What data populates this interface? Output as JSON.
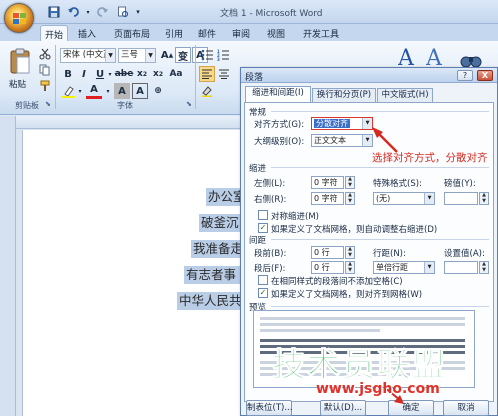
{
  "window": {
    "title": "文档 1 - Microsoft Word"
  },
  "ribbon": {
    "tabs": [
      "开始",
      "插入",
      "页面布局",
      "引用",
      "邮件",
      "审阅",
      "视图",
      "开发工具"
    ],
    "active_tab": "开始",
    "font_name": "宋体 (中文正)",
    "font_size": "三号",
    "clipboard_group": "剪贴板",
    "font_group": "字体",
    "paste_label": "粘贴",
    "wen_glyph": "变",
    "a_glyph": "A"
  },
  "document": {
    "lines": [
      "办公室",
      "破釜沉",
      "我准备走",
      "有志者事",
      "中华人民共"
    ]
  },
  "dialog": {
    "title": "段落",
    "help": "?",
    "close": "X",
    "tabs": [
      "缩进和间距(I)",
      "换行和分页(P)",
      "中文版式(H)"
    ],
    "general": {
      "heading": "常规",
      "alignment_label": "对齐方式(G):",
      "alignment_value": "分散对齐",
      "outline_label": "大纲级别(O):",
      "outline_value": "正文文本"
    },
    "indent": {
      "heading": "缩进",
      "left_label": "左侧(L):",
      "left_value": "0 字符",
      "right_label": "右侧(R):",
      "right_value": "0 字符",
      "special_label": "特殊格式(S):",
      "special_value": "(无)",
      "by_label": "磅值(Y):",
      "by_value": "",
      "mirror_label": "对称缩进(M)",
      "mirror_checked": false,
      "auto_adjust_label": "如果定义了文档网格，则自动调整右缩进(D)",
      "auto_adjust_checked": true
    },
    "spacing": {
      "heading": "间距",
      "before_label": "段前(B):",
      "before_value": "0 行",
      "after_label": "段后(F):",
      "after_value": "0 行",
      "line_label": "行距(N):",
      "line_value": "单倍行距",
      "at_label": "设置值(A):",
      "at_value": "",
      "no_space_label": "在相同样式的段落间不添加空格(C)",
      "no_space_checked": false,
      "snap_grid_label": "如果定义了文档网格，则对齐到网格(W)",
      "snap_grid_checked": true
    },
    "preview_heading": "预览",
    "buttons": {
      "tabs": "制表位(T)...",
      "default": "默认(D)...",
      "ok": "确定",
      "cancel": "取消"
    }
  },
  "annotation": "选择对齐方式，分散对齐",
  "watermark": {
    "text": "技术员联盟",
    "url": "www.jsgho.com"
  }
}
